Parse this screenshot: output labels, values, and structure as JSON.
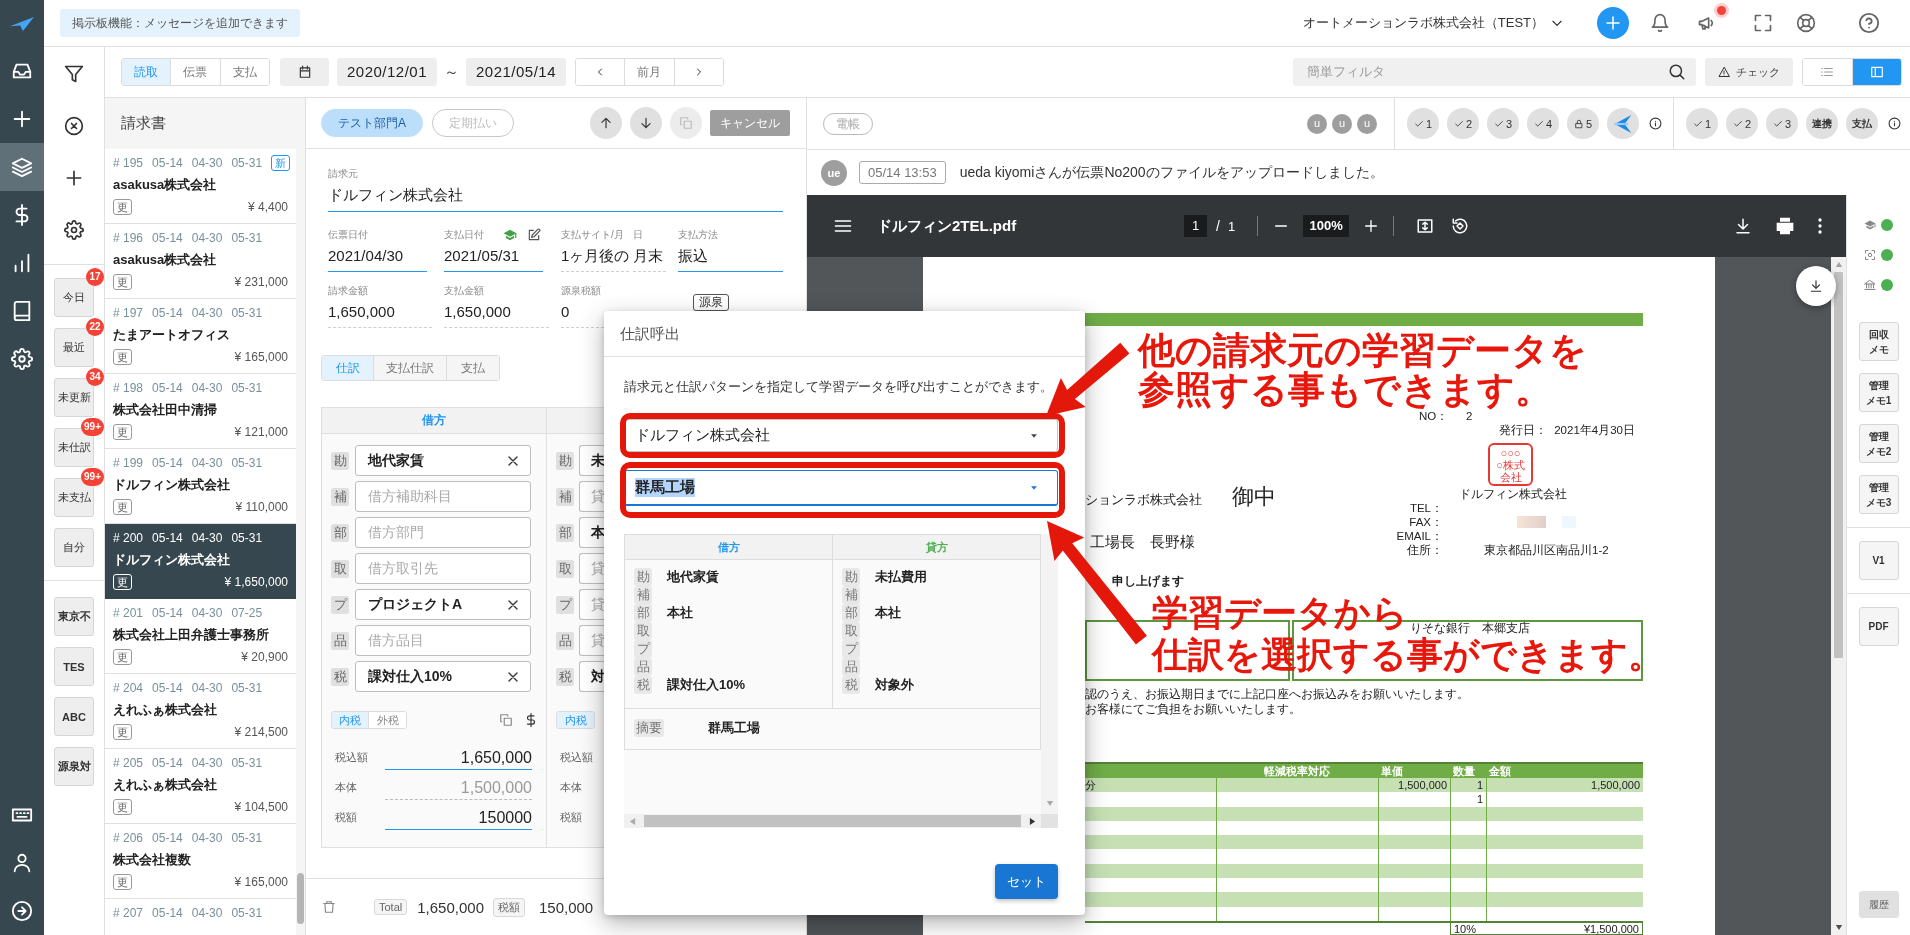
{
  "nav": {
    "items": [
      {
        "selected": false
      },
      {
        "selected": false
      },
      {
        "selected": true
      },
      {
        "selected": false
      },
      {
        "selected": false
      },
      {
        "selected": false
      },
      {
        "selected": false
      }
    ]
  },
  "header": {
    "notice": "掲示板機能：メッセージを追加できます",
    "company": "オートメーションラボ株式会社（TEST）",
    "announcement_alert": true
  },
  "filters": {
    "quick": [
      {
        "label": "今日",
        "count": "17"
      },
      {
        "label": "最近",
        "count": "22"
      },
      {
        "label": "未更新",
        "count": "34"
      },
      {
        "label": "未仕訳",
        "count": "99+"
      },
      {
        "label": "未支払",
        "count": "99+"
      },
      {
        "label": "自分"
      }
    ],
    "tags": [
      "東京不",
      "TES",
      "ABC",
      "源泉対"
    ]
  },
  "toolbar": {
    "modes": [
      {
        "label": "読取",
        "selected": true
      },
      {
        "label": "伝票",
        "selected": false
      },
      {
        "label": "支払",
        "selected": false
      }
    ],
    "date_from": "2020/12/01",
    "range_sign": "～",
    "date_to": "2021/05/14",
    "period": "前月",
    "filter_placeholder": "簡単フィルタ",
    "check_button": "チェック",
    "views": [
      {
        "selected": false
      },
      {
        "selected": true
      }
    ]
  },
  "invoice_list": {
    "title": "請求書",
    "items": [
      {
        "number": "# 195",
        "dates": [
          "05-14",
          "04-30",
          "05-31"
        ],
        "badge": "新",
        "name": "asakusa株式会社",
        "tag": "更",
        "amount": "¥ 4,400",
        "selected": false
      },
      {
        "number": "# 196",
        "dates": [
          "05-14",
          "04-30",
          "05-31"
        ],
        "name": "asakusa株式会社",
        "tag": "更",
        "amount": "¥ 231,000",
        "selected": false
      },
      {
        "number": "# 197",
        "dates": [
          "05-14",
          "04-30",
          "05-31"
        ],
        "name": "たまアートオフィス",
        "tag": "更",
        "amount": "¥ 165,000",
        "selected": false
      },
      {
        "number": "# 198",
        "dates": [
          "05-14",
          "04-30",
          "05-31"
        ],
        "name": "株式会社田中清掃",
        "tag": "更",
        "amount": "¥ 121,000",
        "selected": false
      },
      {
        "number": "# 199",
        "dates": [
          "05-14",
          "04-30",
          "05-31"
        ],
        "name": "ドルフィン株式会社",
        "tag": "更",
        "amount": "¥ 110,000",
        "selected": false
      },
      {
        "number": "# 200",
        "dates": [
          "05-14",
          "04-30",
          "05-31"
        ],
        "name": "ドルフィン株式会社",
        "tag": "更",
        "amount": "¥ 1,650,000",
        "selected": true
      },
      {
        "number": "# 201",
        "dates": [
          "05-14",
          "04-30",
          "07-25"
        ],
        "name": "株式会社上田弁護士事務所",
        "tag": "更",
        "amount": "¥ 20,900",
        "selected": false
      },
      {
        "number": "# 204",
        "dates": [
          "05-14",
          "04-30",
          "05-31"
        ],
        "name": "えれふぁ株式会社",
        "tag": "更",
        "amount": "¥ 214,500",
        "selected": false
      },
      {
        "number": "# 205",
        "dates": [
          "05-14",
          "04-30",
          "05-31"
        ],
        "name": "えれふぁ株式会社",
        "tag": "更",
        "amount": "¥ 104,500",
        "selected": false
      },
      {
        "number": "# 206",
        "dates": [
          "05-14",
          "04-30",
          "05-31"
        ],
        "name": "株式会社複数",
        "tag": "更",
        "amount": "¥ 165,000",
        "selected": false
      },
      {
        "number": "# 207",
        "dates": [
          "05-14",
          "04-30",
          "05-31"
        ],
        "selected": false
      }
    ]
  },
  "form": {
    "tags": [
      {
        "label": "テスト部門A",
        "selected": true
      },
      {
        "label": "定期払い",
        "selected": false
      }
    ],
    "cancel_button": "キャンセル",
    "vendor": {
      "label": "請求元",
      "value": "ドルフィン株式会社"
    },
    "dates": [
      {
        "label": "伝票日付",
        "value": "2021/04/30",
        "readonly": false,
        "learned": false
      },
      {
        "label": "支払日付",
        "value": "2021/05/31",
        "readonly": false,
        "learned": true
      },
      {
        "label": "支払サイト/月",
        "value": "1ヶ月後の",
        "readonly": true,
        "learned": false
      },
      {
        "label": "日",
        "value": "月末",
        "readonly": true,
        "learned": false
      },
      {
        "label": "支払方法",
        "value": "振込",
        "readonly": false,
        "learned": false
      }
    ],
    "amounts": [
      {
        "label": "請求金額",
        "value": "1,650,000",
        "readonly": true
      },
      {
        "label": "支払金額",
        "value": "1,650,000",
        "readonly": true
      },
      {
        "label": "源泉税額",
        "value": "0",
        "readonly": true
      }
    ],
    "withholding_button": "源泉",
    "tabs": [
      {
        "label": "仕訳",
        "selected": true
      },
      {
        "label": "支払仕訳",
        "selected": false
      },
      {
        "label": "支払",
        "selected": false
      }
    ],
    "debit": {
      "title": "借方",
      "rows": [
        {
          "code": "勘",
          "value": "地代家賃"
        },
        {
          "code": "補",
          "placeholder": "借方補助科目"
        },
        {
          "code": "部",
          "placeholder": "借方部門"
        },
        {
          "code": "取",
          "placeholder": "借方取引先"
        },
        {
          "code": "プ",
          "value": "プロジェクトA"
        },
        {
          "code": "品",
          "placeholder": "借方品目"
        },
        {
          "code": "税",
          "value": "課対仕入10%"
        }
      ],
      "tax_modes": [
        {
          "label": "内税",
          "selected": true
        },
        {
          "label": "外税",
          "selected": false
        }
      ],
      "totals": [
        {
          "label": "税込額",
          "value": "1,650,000",
          "readonly": false
        },
        {
          "label": "本体",
          "value": "1,500,000",
          "readonly": true
        },
        {
          "label": "税額",
          "value": "150000",
          "readonly": false
        }
      ]
    },
    "credit": {
      "rows": [
        {
          "code": "勘",
          "value": "未"
        },
        {
          "code": "補",
          "placeholder": "貸"
        },
        {
          "code": "部",
          "value": "本"
        },
        {
          "code": "取",
          "placeholder": "貸"
        },
        {
          "code": "プ",
          "placeholder": "貸"
        },
        {
          "code": "品",
          "placeholder": "貸"
        },
        {
          "code": "税",
          "value": "対"
        }
      ],
      "tax_modes": [
        {
          "label": "内税",
          "selected": true
        }
      ],
      "totals": [
        {
          "label": "税込額"
        },
        {
          "label": "本体"
        },
        {
          "label": "税額"
        }
      ]
    },
    "footer": {
      "total_label": "Total",
      "total": "1,650,000",
      "tax_label": "税額",
      "tax": "150,000"
    }
  },
  "record_bar": {
    "ledger_tag": "電帳",
    "users": [
      "u",
      "u",
      "u"
    ],
    "checks": [
      {
        "kind": "check",
        "label": "1"
      },
      {
        "kind": "check",
        "label": "2"
      },
      {
        "kind": "check",
        "label": "3"
      },
      {
        "kind": "check",
        "label": "4"
      },
      {
        "kind": "lock",
        "label": "5"
      },
      {
        "kind": "logo"
      }
    ],
    "approvals": [
      {
        "kind": "check",
        "label": "1"
      },
      {
        "kind": "check",
        "label": "2"
      },
      {
        "kind": "check",
        "label": "3"
      },
      {
        "kind": "text",
        "label": "連携"
      },
      {
        "kind": "text",
        "label": "支払"
      }
    ]
  },
  "activity": {
    "avatar": "ue",
    "time": "05/14 13:53",
    "message": "ueda kiyomiさんが伝票No200のファイルをアップロードしました。"
  },
  "pdf": {
    "filename": "ドルフィン2TEL.pdf",
    "page": "1",
    "separator": "/",
    "page_count": "1",
    "zoom": "100%"
  },
  "document": {
    "number_label": "NO：",
    "number": "2",
    "issue_label": "発行日：",
    "issue_date": "2021年4月30日",
    "stamp": [
      "○○○",
      "○株式",
      "会社"
    ],
    "recipient": "ションラボ株式会社",
    "honorific": "御中",
    "attention": "工場長　長野様",
    "issuer": "ドルフィン株式会社",
    "contacts": [
      {
        "label": "TEL：",
        "redacted": false
      },
      {
        "label": "FAX：",
        "redacted": true
      },
      {
        "label": "EMAIL：",
        "redacted": false
      },
      {
        "label": "住所：",
        "value": "東京都品川区南品川1-2",
        "redacted": false
      }
    ],
    "request": "申し上げます",
    "bank": "りそな銀行　本郷支店",
    "notes": [
      "認のうえ、お振込期日までに上記口座へお振込みをお願いいたします。",
      "お客様にてご負担をお願いいたします。"
    ],
    "table": {
      "columns": [
        "軽減税率対応",
        "単価",
        "数量",
        "金額"
      ],
      "rows": [
        {
          "description": "分",
          "unit_price": "1,500,000",
          "quantity": "1",
          "amount": "1,500,000"
        },
        {
          "quantity": "1"
        }
      ]
    },
    "tax_rate": "10%",
    "tax_total": "¥1,500,000"
  },
  "side_panel": {
    "status": [
      {
        "ok": true
      },
      {
        "ok": true
      },
      {
        "ok": true
      }
    ],
    "memos": [
      {
        "lines": [
          "回収",
          "メモ"
        ]
      },
      {
        "lines": [
          "管理",
          "メモ1"
        ]
      },
      {
        "lines": [
          "管理",
          "メモ2"
        ]
      },
      {
        "lines": [
          "管理",
          "メモ3"
        ]
      }
    ],
    "version_button": "V1",
    "pdf_button": "PDF",
    "history_button": "履歴"
  },
  "dialog": {
    "title": "仕訳呼出",
    "description": "請求元と仕訳パターンを指定して学習データを呼び出すことができます。",
    "vendor_select": {
      "value": "ドルフィン株式会社",
      "focused": false
    },
    "pattern_select": {
      "value": "群馬工場",
      "focused": true
    },
    "table": {
      "debit_title": "借方",
      "credit_title": "貸方",
      "debit": [
        {
          "code": "勘",
          "value": "地代家賃"
        },
        {
          "code": "補"
        },
        {
          "code": "部",
          "value": "本社"
        },
        {
          "code": "取"
        },
        {
          "code": "プ"
        },
        {
          "code": "品"
        },
        {
          "code": "税",
          "value": "課対仕入10%"
        }
      ],
      "credit": [
        {
          "code": "勘",
          "value": "未払費用"
        },
        {
          "code": "補"
        },
        {
          "code": "部",
          "value": "本社"
        },
        {
          "code": "取"
        },
        {
          "code": "プ"
        },
        {
          "code": "品"
        },
        {
          "code": "税",
          "value": "対象外"
        }
      ],
      "summary_code": "摘要",
      "summary": "群馬工場"
    },
    "set_button": "セット"
  },
  "callouts": [
    {
      "lines": [
        "他の請求元の学習データを",
        "参照する事もできます。"
      ]
    },
    {
      "lines": [
        "学習データから",
        "仕訳を選択する事ができます。"
      ]
    }
  ]
}
